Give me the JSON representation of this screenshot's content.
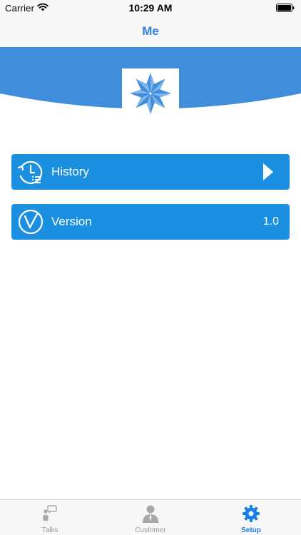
{
  "status_bar": {
    "carrier": "Carrier",
    "time": "10:29 AM"
  },
  "nav": {
    "title": "Me"
  },
  "menu": [
    {
      "label": "History",
      "icon": "history-clock-icon",
      "accessory": "chevron-right-icon"
    },
    {
      "label": "Version",
      "icon": "version-v-icon",
      "value": "1.0"
    }
  ],
  "tabs": [
    {
      "label": "Talks",
      "icon": "talks-icon",
      "active": false
    },
    {
      "label": "Customer",
      "icon": "customer-icon",
      "active": false
    },
    {
      "label": "Setup",
      "icon": "gear-icon",
      "active": true
    }
  ],
  "colors": {
    "accent": "#1b8fe0",
    "nav_title": "#2a80d4",
    "banner": "#3f8ddb",
    "tab_active": "#1a7fe0",
    "tab_inactive": "#9a9a9a",
    "bar_background": "#f7f7f7"
  }
}
